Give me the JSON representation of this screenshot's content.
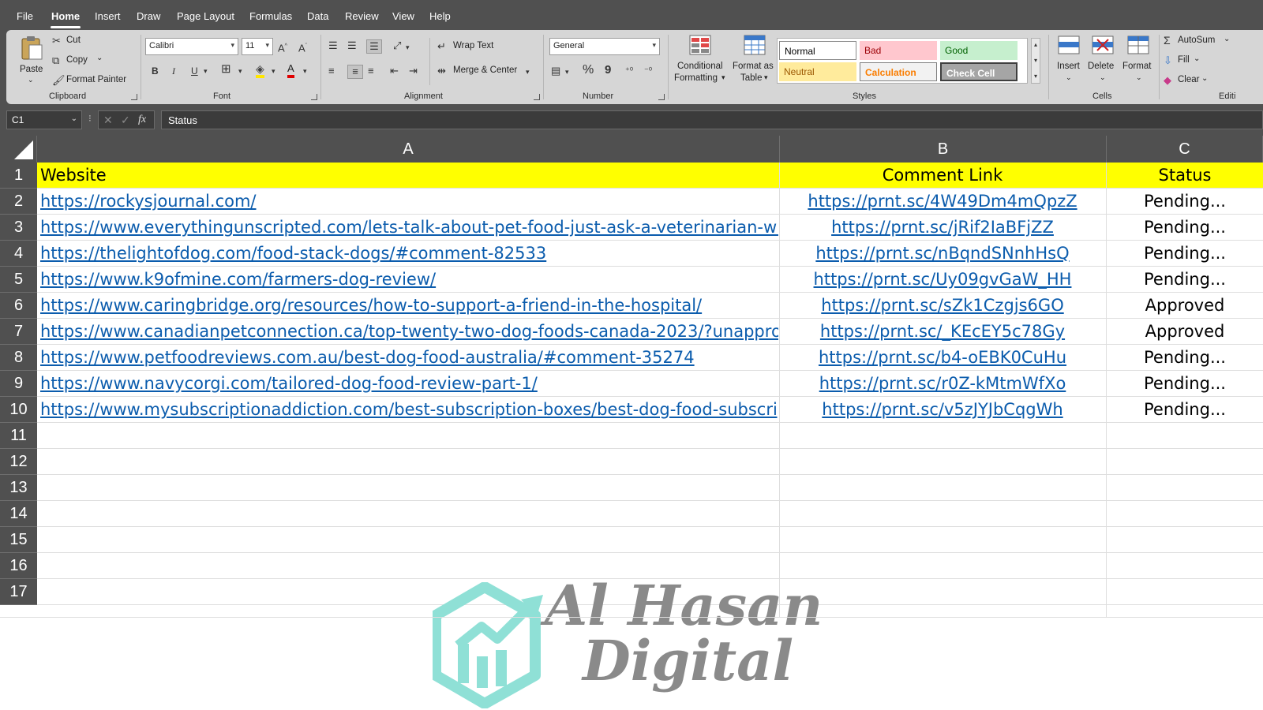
{
  "menu": {
    "tabs": [
      {
        "label": "File"
      },
      {
        "label": "Home"
      },
      {
        "label": "Insert"
      },
      {
        "label": "Draw"
      },
      {
        "label": "Page Layout"
      },
      {
        "label": "Formulas"
      },
      {
        "label": "Data"
      },
      {
        "label": "Review"
      },
      {
        "label": "View"
      },
      {
        "label": "Help"
      }
    ],
    "active": "Home"
  },
  "ribbon": {
    "clipboard": {
      "paste": "Paste",
      "cut": "Cut",
      "copy": "Copy",
      "format_painter": "Format Painter",
      "label": "Clipboard"
    },
    "font": {
      "name": "Calibri",
      "size": "11",
      "bold": "B",
      "italic": "I",
      "underline": "U",
      "label": "Font"
    },
    "alignment": {
      "wrap_text": "Wrap Text",
      "merge_center": "Merge & Center",
      "label": "Alignment"
    },
    "number": {
      "format": "General",
      "percent": "%",
      "comma": "9",
      "label": "Number"
    },
    "styles": {
      "conditional_line1": "Conditional",
      "conditional_line2": "Formatting",
      "format_table_line1": "Format as",
      "format_table_line2": "Table",
      "normal": "Normal",
      "bad": "Bad",
      "good": "Good",
      "neutral": "Neutral",
      "calculation": "Calculation",
      "check_cell": "Check Cell",
      "label": "Styles"
    },
    "cells": {
      "insert": "Insert",
      "delete": "Delete",
      "format": "Format",
      "label": "Cells"
    },
    "editing": {
      "autosum": "AutoSum",
      "fill": "Fill",
      "clear": "Clear",
      "label": "Editi"
    }
  },
  "formula_bar": {
    "name_box": "C1",
    "fx": "fx",
    "content": "Status"
  },
  "sheet": {
    "columns": [
      "A",
      "B",
      "C"
    ],
    "row_numbers": [
      "1",
      "2",
      "3",
      "4",
      "5",
      "6",
      "7",
      "8",
      "9",
      "10",
      "11",
      "12",
      "13",
      "14",
      "15",
      "16",
      "17"
    ],
    "header_row": {
      "a": "Website",
      "b": "Comment Link",
      "c": "Status"
    },
    "rows": [
      {
        "a": "https://rockysjournal.com/",
        "b": "https://prnt.sc/4W49Dm4mQpzZ",
        "c": "Pending..."
      },
      {
        "a": "https://www.everythingunscripted.com/lets-talk-about-pet-food-just-ask-a-veterinarian-with",
        "b": "https://prnt.sc/jRif2IaBFjZZ",
        "c": "Pending..."
      },
      {
        "a": "https://thelightofdog.com/food-stack-dogs/#comment-82533",
        "b": "https://prnt.sc/nBqndSNnhHsQ",
        "c": "Pending..."
      },
      {
        "a": "https://www.k9ofmine.com/farmers-dog-review/",
        "b": "https://prnt.sc/Uy09gvGaW_HH",
        "c": "Pending..."
      },
      {
        "a": "https://www.caringbridge.org/resources/how-to-support-a-friend-in-the-hospital/",
        "b": "https://prnt.sc/sZk1Czgjs6GO",
        "c": "Approved"
      },
      {
        "a": "https://www.canadianpetconnection.ca/top-twenty-two-dog-foods-canada-2023/?unapprove",
        "b": "https://prnt.sc/_KEcEY5c78Gy",
        "c": "Approved"
      },
      {
        "a": "https://www.petfoodreviews.com.au/best-dog-food-australia/#comment-35274",
        "b": "https://prnt.sc/b4-oEBK0CuHu",
        "c": "Pending..."
      },
      {
        "a": "https://www.navycorgi.com/tailored-dog-food-review-part-1/",
        "b": "https://prnt.sc/r0Z-kMtmWfXo",
        "c": "Pending..."
      },
      {
        "a": "https://www.mysubscriptionaddiction.com/best-subscription-boxes/best-dog-food-subscript",
        "b": "https://prnt.sc/v5zJYJbCqgWh",
        "c": "Pending..."
      }
    ]
  },
  "watermark": {
    "line1": "Al Hasan",
    "line2": "Digital"
  },
  "colors": {
    "chrome": "#505050",
    "ribbon": "#d6d6d6",
    "header_fill": "#ffff00",
    "link": "#0b5cad",
    "logo": "#8fe0d6",
    "bad_fill": "#ffc7ce",
    "good_fill": "#c6efce",
    "neutral_fill": "#ffeb9c"
  }
}
